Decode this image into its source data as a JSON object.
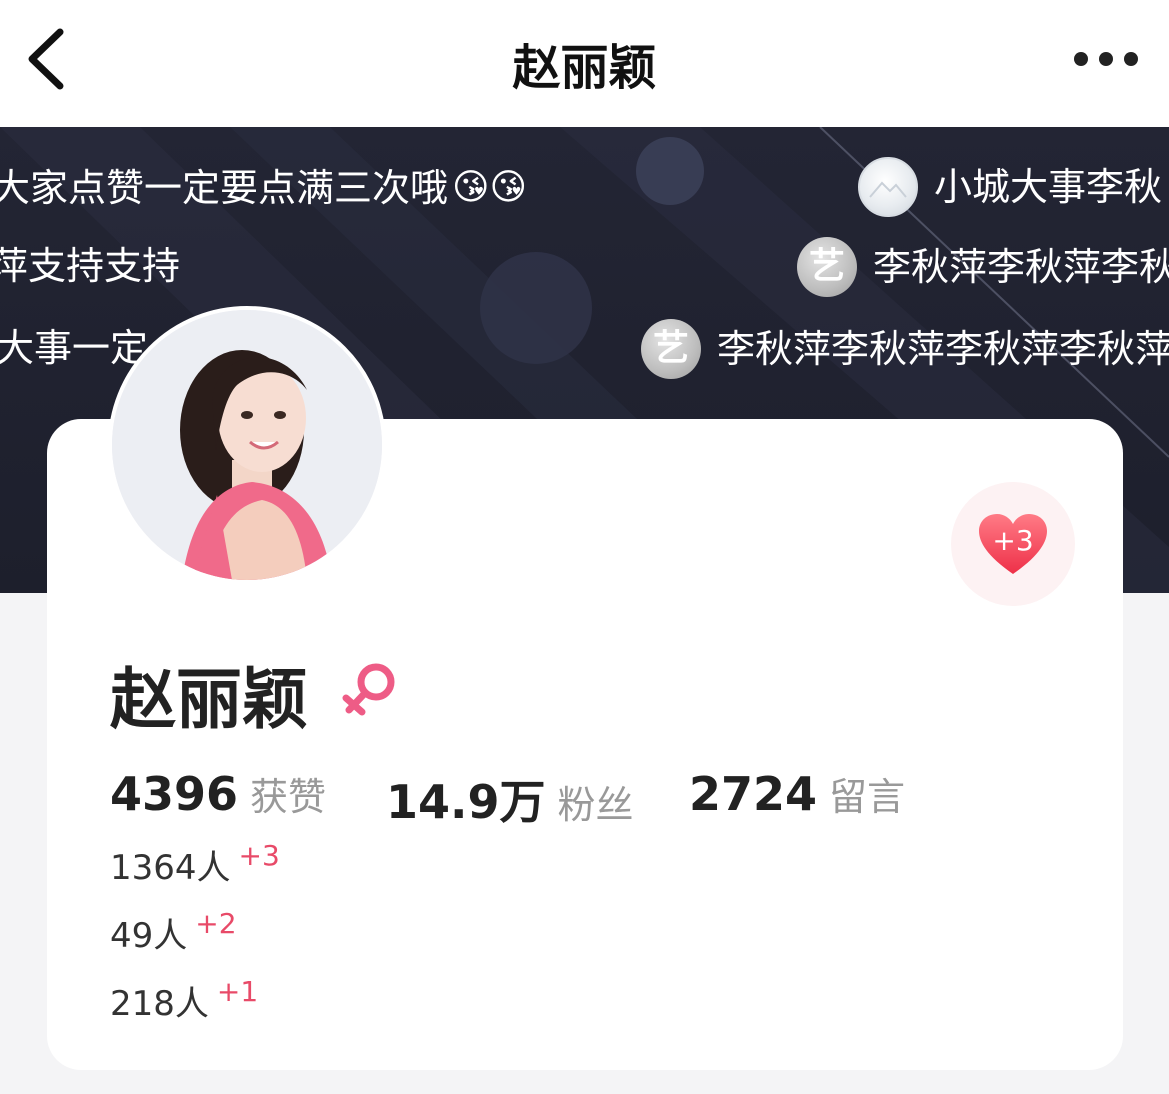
{
  "header": {
    "title": "赵丽颖",
    "back_icon": "chevron-left-icon",
    "more_icon": "more-dots-icon"
  },
  "banner": {
    "danmu": [
      {
        "text": "大家点赞一定要点满三次哦",
        "emoji": "😘😘"
      },
      {
        "text": "萍支持支持"
      },
      {
        "text": "大事一定"
      },
      {
        "text": "小城大事李秋",
        "avatar": "image-avatar"
      },
      {
        "text": "李秋萍李秋萍李秋",
        "avatar": "艺"
      },
      {
        "text": "李秋萍李秋萍李秋萍李秋萍",
        "avatar": "艺"
      }
    ]
  },
  "profile": {
    "name": "赵丽颖",
    "gender_icon": "female-icon",
    "like_button": {
      "count": "+3",
      "icon": "heart-icon",
      "color": "#f04a62"
    },
    "stats": [
      {
        "value": "4396",
        "label": "获赞"
      },
      {
        "value": "14.9万",
        "label": "粉丝"
      },
      {
        "value": "2724",
        "label": "留言"
      }
    ],
    "rows": [
      {
        "count": "1364人",
        "plus": "+3"
      },
      {
        "count": "49人",
        "plus": "+2"
      },
      {
        "count": "218人",
        "plus": "+1"
      }
    ]
  },
  "colors": {
    "accent": "#e84a68",
    "banner_bg": "#232534"
  }
}
